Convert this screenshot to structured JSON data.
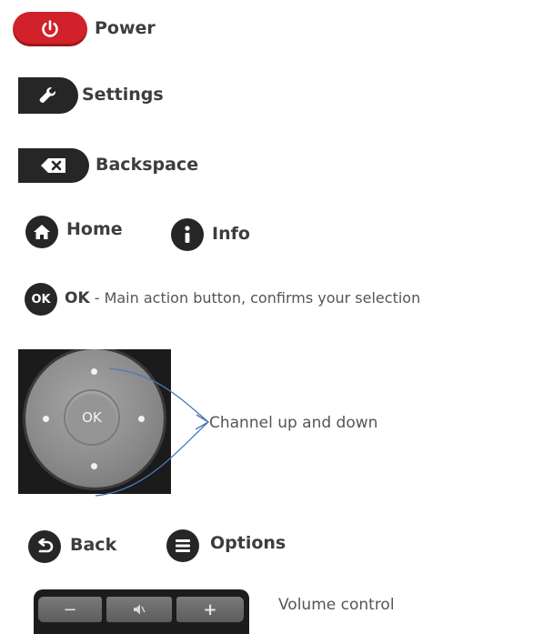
{
  "power": {
    "label": "Power",
    "color": "#d1212a",
    "icon": "power-icon"
  },
  "settings": {
    "label": "Settings",
    "icon": "wrench-icon"
  },
  "backspace": {
    "label": "Backspace",
    "icon": "backspace-icon"
  },
  "home": {
    "label": "Home",
    "icon": "home-icon"
  },
  "info": {
    "label": "Info",
    "icon": "info-icon"
  },
  "ok": {
    "icon_text": "OK",
    "label": "OK",
    "description": " - Main action button, confirms your selection"
  },
  "dpad": {
    "center_label": "OK",
    "annotation": "Channel up and down",
    "arrow_color": "#4a78b8"
  },
  "back": {
    "label": "Back",
    "icon": "back-icon"
  },
  "options": {
    "label": "Options",
    "icon": "options-icon"
  },
  "volume": {
    "minus": "−",
    "mute": "🔇",
    "plus": "+",
    "annotation": "Volume control"
  }
}
